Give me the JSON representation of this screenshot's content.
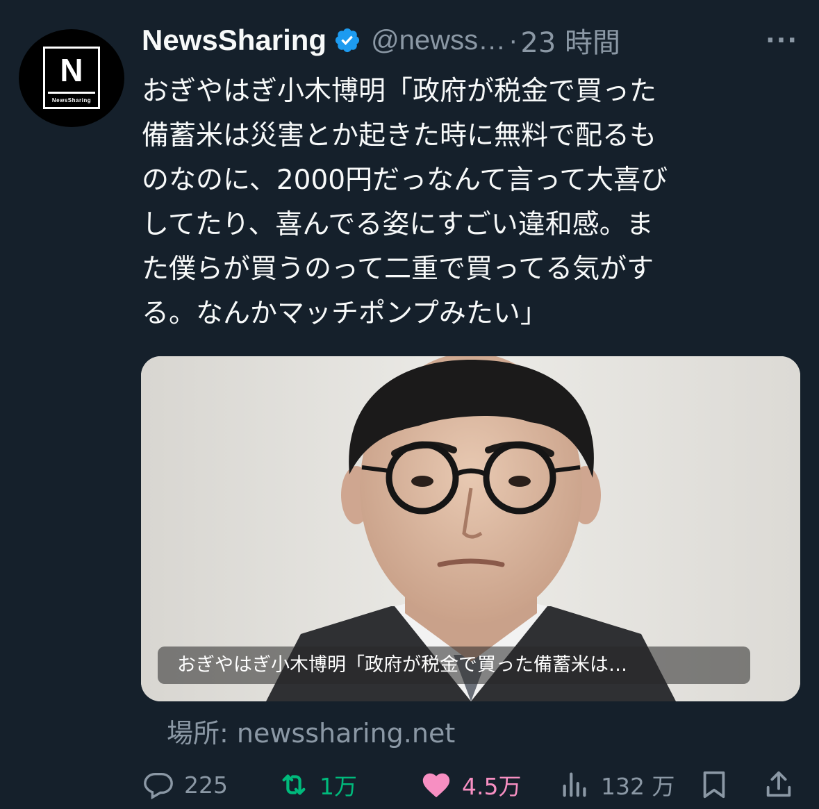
{
  "author": {
    "display_name": "NewsSharing",
    "handle": "@newss…",
    "separator": "·",
    "time": "23 時間",
    "avatar_letter": "N",
    "avatar_caption": "NewsSharing"
  },
  "tweet_text": "おぎやはぎ小木博明「政府が税金で買った\n備蓄米は災害とか起きた時に無料で配るも\nのなのに、2000円だっなんて言って大喜び\nしてたり、喜んでる姿にすごい違和感。ま\nた僕らが買うのって二重で買ってる気がす\nる。なんかマッチポンプみたい」",
  "card": {
    "caption": "おぎやはぎ小木博明「政府が税金で買った備蓄米は…"
  },
  "source_label": "場所: newssharing.net",
  "actions": {
    "replies": "225",
    "retweets": "1万",
    "likes": "4.5万",
    "views": "132 万"
  },
  "colors": {
    "background": "#15202b",
    "secondary_text": "#8b98a5",
    "retweet_green": "#00ba7c",
    "like_pink": "#f91880",
    "verified_blue": "#1d9bf0"
  },
  "icons": [
    "more-icon",
    "verified-icon",
    "reply-icon",
    "retweet-icon",
    "like-icon",
    "views-icon",
    "bookmark-icon",
    "share-icon"
  ]
}
